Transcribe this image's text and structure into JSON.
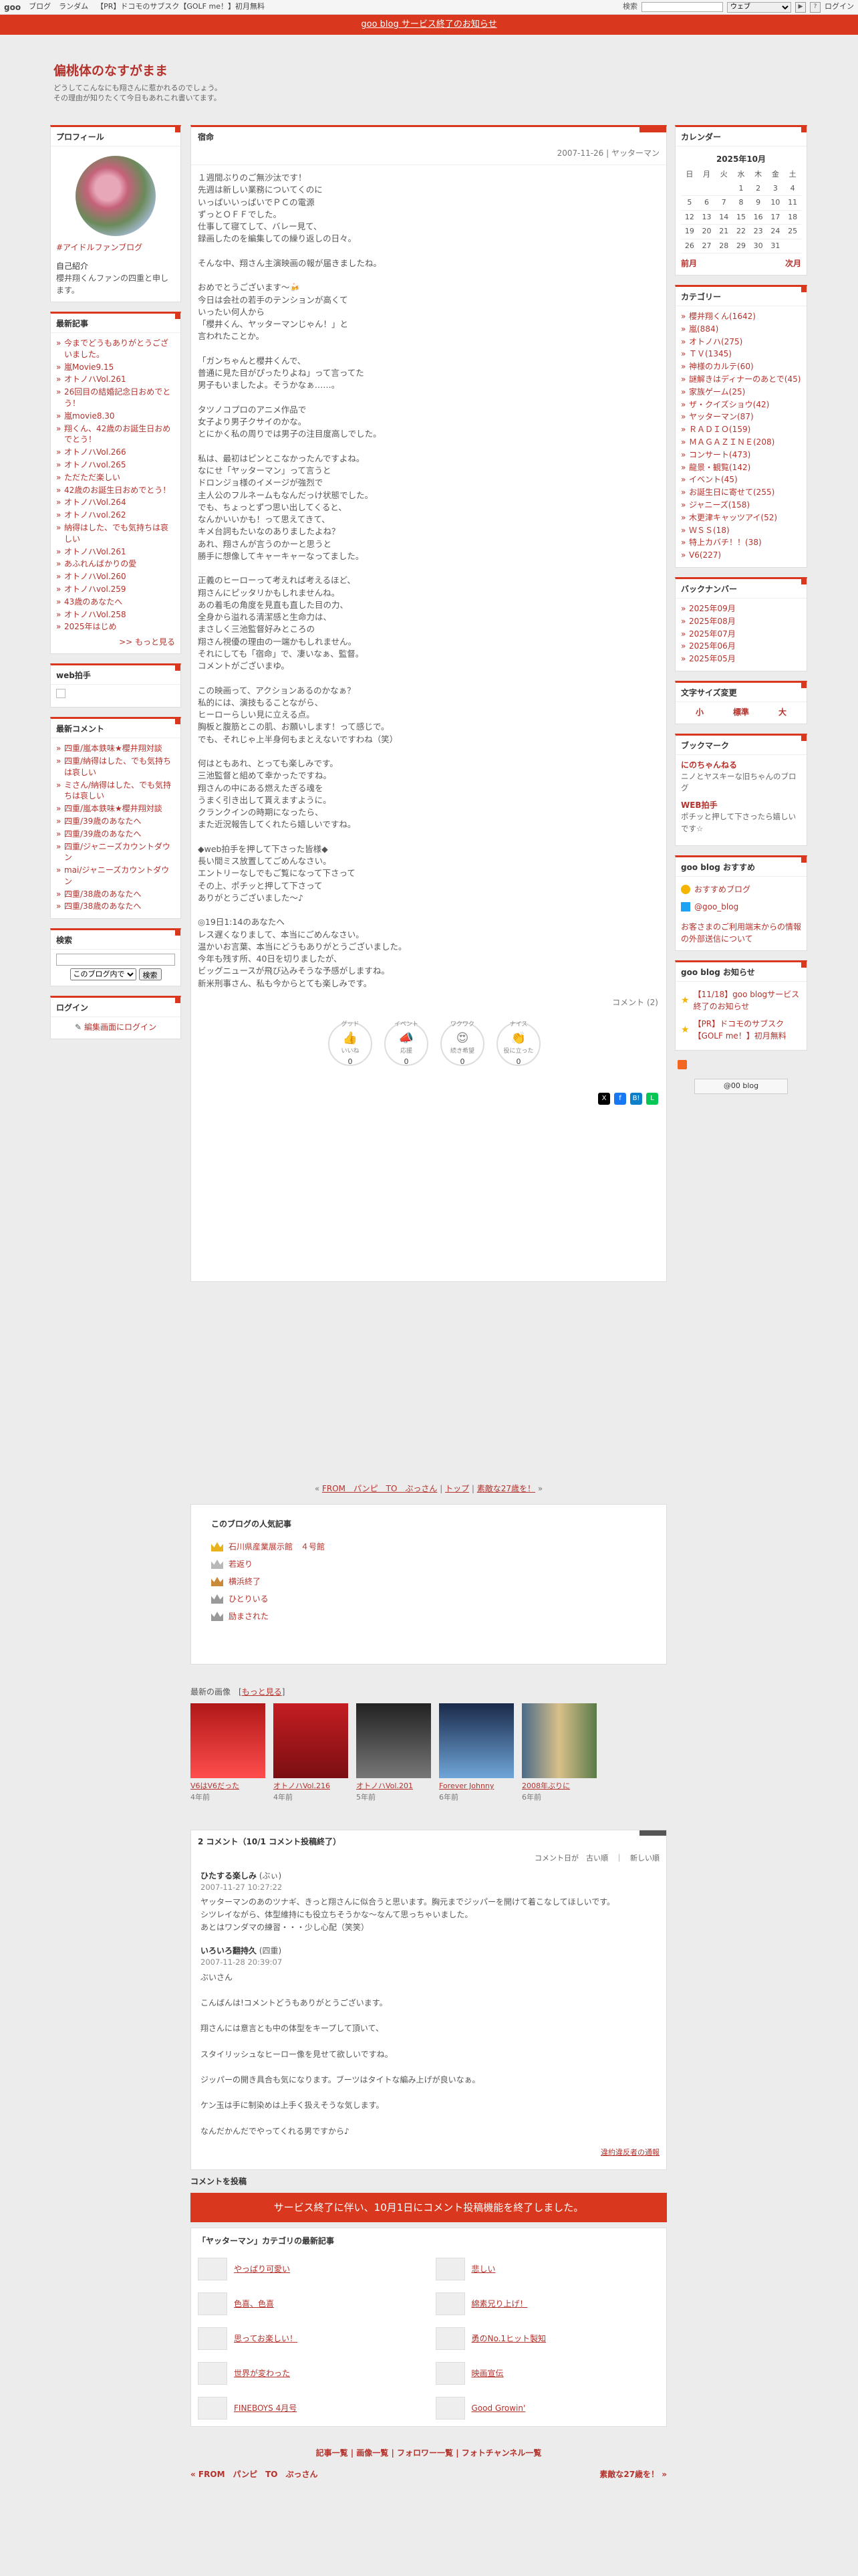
{
  "topbar": {
    "logo": "goo",
    "links": [
      "ブログ",
      "ランダム",
      "【PR】ドコモのサブスク【GOLF me！】初月無料"
    ],
    "search_label": "検索",
    "scope": "ウェブ",
    "login": "ログイン"
  },
  "notice": "goo blog サービス終了のお知らせ",
  "header": {
    "title": "偏桃体のなすがまま",
    "desc_1": "どうしてこんなにも翔さんに惹かれるのでしょう。",
    "desc_2": "その理由が知りたくて今日もあれこれ書いてます。"
  },
  "profile": {
    "title": "プロフィール",
    "name": "#アイドルファンブログ",
    "intro_label": "自己紹介",
    "intro": "櫻井翔くんファンの四重と申します。"
  },
  "recent": {
    "title": "最新記事",
    "items": [
      "今までどうもありがとうございました。",
      "嵐Movie9.15",
      "オトノハVol.261",
      "26回目の結婚記念日おめでとう！",
      "嵐movie8.30",
      "翔くん、42歳のお誕生日おめでとう！",
      "オトノハVol.266",
      "オトノハvol.265",
      "ただただ楽しい",
      "42歳のお誕生日おめでとう！",
      "オトノハVol.264",
      "オトノハvol.262",
      "納得はした、でも気持ちは哀しい",
      "オトノハVol.261",
      "あふれんばかりの愛",
      "オトノハVol.260",
      "オトノハvol.259",
      "43歳のあなたへ",
      "オトノハVol.258",
      "2025年はじめ"
    ],
    "more": ">> もっと見る"
  },
  "webclap": {
    "title": "web拍手"
  },
  "recent_comments": {
    "title": "最新コメント",
    "items": [
      "四重/嵐本鉄味★櫻井翔対談",
      "四重/納得はした、でも気持ちは哀しい",
      "ミさん/納得はした、でも気持ちは哀しい",
      "四重/嵐本鉄味★櫻井翔対談",
      "四重/39歳のあなたへ",
      "四重/39歳のあなたへ",
      "四重/ジャニーズカウントダウン",
      "mai/ジャニーズカウントダウン",
      "四重/38歳のあなたへ",
      "四重/38歳のあなたへ"
    ]
  },
  "search": {
    "title": "検索",
    "scope": "このブログ内で",
    "button": "検索"
  },
  "login": {
    "title": "ログイン",
    "link": "編集画面にログイン"
  },
  "article": {
    "category": "宿命",
    "date": "2007-11-26 | ヤッターマン",
    "text": "１週間ぶりのご無沙汰です！\n先週は新しい業務についてくのに\nいっぱいいっぱいでＰＣの電源\nずっとＯＦＦでした。\n仕事して寝てして、バレー見て、\n録画したのを編集しての繰り返しの日々。\n\nそんな中、翔さん主演映画の報が届きましたね。\n\nおめでとうございます～🍻\n今日は会社の若手のテンションが高くて\nいったい何人から\n「櫻井くん、ヤッターマンじゃん！」と\n言われたことか。\n\n「ガンちゃんと櫻井くんで、\n普通に見た目がぴったりよね」って言ってた\n男子もいましたよ。そうかなぁ……。\n\nタツノコプロのアニメ作品で\n女子より男子クサイのかな。\nとにかく私の周りでは男子の注目度高しでした。\n\n私は、最初はピンとこなかったんですよね。\nなにせ「ヤッターマン」って言うと\nドロンジョ様のイメージが強烈で\n主人公のフルネームもなんだっけ状態でした。\nでも、ちょっとずつ思い出してくると、\nなんかいいかも！って思えてきて、\nキメ台詞もたいなのありましたよね？\nあれ、翔さんが言うのかーと思うと\n勝手に想像してキャーキャーなってました。\n\n正義のヒーローって考えれば考えるほど、\n翔さんにピッタリかもしれませんね。\nあの着毛の角度を見直も直した目の力、\n全身から溢れる清潔感と生命力は、\nまさしく三池監督好みところの\n翔さん視優の理由の一端かもしれません。\nそれにしても「宿命」で、凄いなぁ、監督。\nコメントがございまゆ。\n\nこの映画って、アクションあるのかなぁ？\n私的には、演技もることながら、\nヒーローらしい見に立える点。\n胸板と腹筋とこの肌、お願いします！って感じで。\nでも、それじゃ上半身何もまとえないですわね（笑）\n\n何はともあれ、とっても楽しみです。\n三池監督と組めて幸かったですね。\n翔さんの中にある燃えたぎる魂を\nうまく引き出して貰えますように。\nクランクインの時期になったら、\nまた近況報告してくれたら嬉しいですね。\n\n◆web拍手を押して下さった皆様◆\n長い間ミス放置してごめんなさい。\nエントリーなしでもご覧になって下さって\nその上、ポチッと押して下さって\nありがとうございました～♪\n\n◎19日1:14のあなたへ\nレス遅くなりまして、本当にごめんなさい。\n温かいお言葉、本当にどうもありがとうございました。\n今年も残す所、40日を切りましたが、\nビッグニュースが飛び込みそうな予感がしますね。\n新米刑事さん、私も今からとても楽しみです。",
    "comment_label": "コメント (2)",
    "reactions": [
      {
        "label": "いいね",
        "top": "グッド",
        "count": "0"
      },
      {
        "label": "応援",
        "top": "イベント",
        "count": "0"
      },
      {
        "label": "続き希望",
        "top": "ワクワク",
        "count": "0"
      },
      {
        "label": "役に立った",
        "top": "ナイス",
        "count": "0"
      }
    ]
  },
  "nav": {
    "prev": "FROM　パンピ　TO　ぷっさん",
    "top": "トップ",
    "next": "素敵な27歳を！"
  },
  "popular": {
    "title": "このブログの人気記事",
    "items": [
      "石川県産業展示館　４号館",
      "若返り",
      "横浜終了",
      "ひとりいる",
      "励まされた"
    ]
  },
  "images": {
    "label": "最新の画像",
    "more": "もっと見る",
    "items": [
      {
        "title": "V6はV6だった",
        "ago": "4年前"
      },
      {
        "title": "オトノハVol.216",
        "ago": "4年前"
      },
      {
        "title": "オトノハVol.201",
        "ago": "5年前"
      },
      {
        "title": "Forever Johnny",
        "ago": "6年前"
      },
      {
        "title": "2008年ぶりに",
        "ago": "6年前"
      }
    ]
  },
  "comments": {
    "header": "2 コメント（10/1 コメント投稿終了）",
    "sort": "コメント日が　古い順　｜　新しい順",
    "items": [
      {
        "who": "ひたする楽しみ",
        "tag": "(ぶぃ)",
        "when": "2007-11-27 10:27:22",
        "txt": "ヤッターマンのあのツナギ、きっと翔さんに似合うと思います。胸元までジッパーを開けて着こなしてほしいです。\nシツレイながら、体型維持にも役立ちそうかな〜なんて思っちゃいました。\nあとはワンダマの練習・・・少し心配（笑笑）"
      },
      {
        "who": "いろいろ翻持久",
        "tag": "(四重)",
        "when": "2007-11-28 20:39:07",
        "txt": "ぶいさん\n\nこんばんは!コメントどうもありがとうございます。\n\n翔さんには意言とも中の体型をキープして頂いて、\n\nスタイリッシュなヒーロー像を見せて欲しいですね。\n\nジッパーの開き具合も気になります。ブーツはタイトな編み上げが良いなぁ。\n\nケン玉は手に制染めは上手く扱えそうな気します。\n\nなんだかんだでやってくれる男ですから♪"
      }
    ],
    "report": "違約違反者の通報"
  },
  "post": {
    "header": "コメントを投稿",
    "notice": "サービス終了に伴い、10月1日にコメント投稿機能を終了しました。"
  },
  "catlatest": {
    "title": "「ヤッターマン」カテゴリの最新記事",
    "items": [
      "やっぱり可愛い",
      "悲しい",
      "色喜、色喜",
      "綿素兄り上げ！",
      "思ってお楽しい！",
      "勇のNo.1ヒット製知",
      "世界が変わった",
      "映画宣伝",
      "FINEBOYS 4月号",
      "Good Growin'"
    ]
  },
  "footer": {
    "links": "記事一覧 | 画像一覧 | フォロワー一覧 | フォトチャンネル一覧",
    "prev": "« FROM　パンピ　TO　ぷっさん",
    "next": "素敵な27歳を！ »"
  },
  "calendar": {
    "title": "カレンダー",
    "month": "2025年10月",
    "days": [
      "日",
      "月",
      "火",
      "水",
      "木",
      "金",
      "土"
    ],
    "weeks": [
      [
        "",
        "",
        "",
        "1",
        "2",
        "3",
        "4"
      ],
      [
        "5",
        "6",
        "7",
        "8",
        "9",
        "10",
        "11"
      ],
      [
        "12",
        "13",
        "14",
        "15",
        "16",
        "17",
        "18"
      ],
      [
        "19",
        "20",
        "21",
        "22",
        "23",
        "24",
        "25"
      ],
      [
        "26",
        "27",
        "28",
        "29",
        "30",
        "31",
        ""
      ]
    ],
    "prev": "前月",
    "next": "次月"
  },
  "categories": {
    "title": "カテゴリー",
    "items": [
      "櫻井翔くん(1642)",
      "嵐(884)",
      "オトノハ(275)",
      "ＴＶ(1345)",
      "神様のカルテ(60)",
      "謎解きはディナーのあとで(45)",
      "家族ゲーム(25)",
      "ザ・クイズショウ(42)",
      "ヤッターマン(87)",
      "ＲＡＤＩＯ(159)",
      "ＭＡＧＡＺＩＮＥ(208)",
      "コンサート(473)",
      "龍景・観覧(142)",
      "イベント(45)",
      "お誕生日に寄せて(255)",
      "ジャニーズ(158)",
      "木更津キャッツアイ(52)",
      "ＷＳＳ(18)",
      "特上カバチ！！(38)",
      "V6(227)"
    ]
  },
  "backnumber": {
    "title": "バックナンバー",
    "items": [
      "2025年09月",
      "2025年08月",
      "2025年07月",
      "2025年06月",
      "2025年05月"
    ]
  },
  "fontsize": {
    "title": "文字サイズ変更",
    "small": "小",
    "mid": "標準",
    "large": "大"
  },
  "bookmark": {
    "title": "ブックマーク",
    "items": [
      {
        "name": "にのちゃんねる",
        "desc": "ニノとヤスキーな旧ちゃんのブログ"
      },
      {
        "name": "WEB拍手",
        "desc": "ポチッと押して下さったら嬉しいです☆"
      }
    ]
  },
  "goo_recommend": {
    "title": "goo blog おすすめ",
    "app": "おすすめブログ",
    "twitter": "@goo_blog",
    "notice": "お客さまのご利用端末からの情報の外部送信について"
  },
  "goo_info": {
    "title": "goo blog お知らせ",
    "items": [
      "【11/18】goo blogサービス終了のお知らせ",
      "【PR】ドコモのサブスク【GOLF me！】初月無料"
    ]
  },
  "blogmark": "@00 blog",
  "colors": {
    "accent": "#d9381e",
    "link": "#b5322c",
    "bg": "#ececec"
  }
}
